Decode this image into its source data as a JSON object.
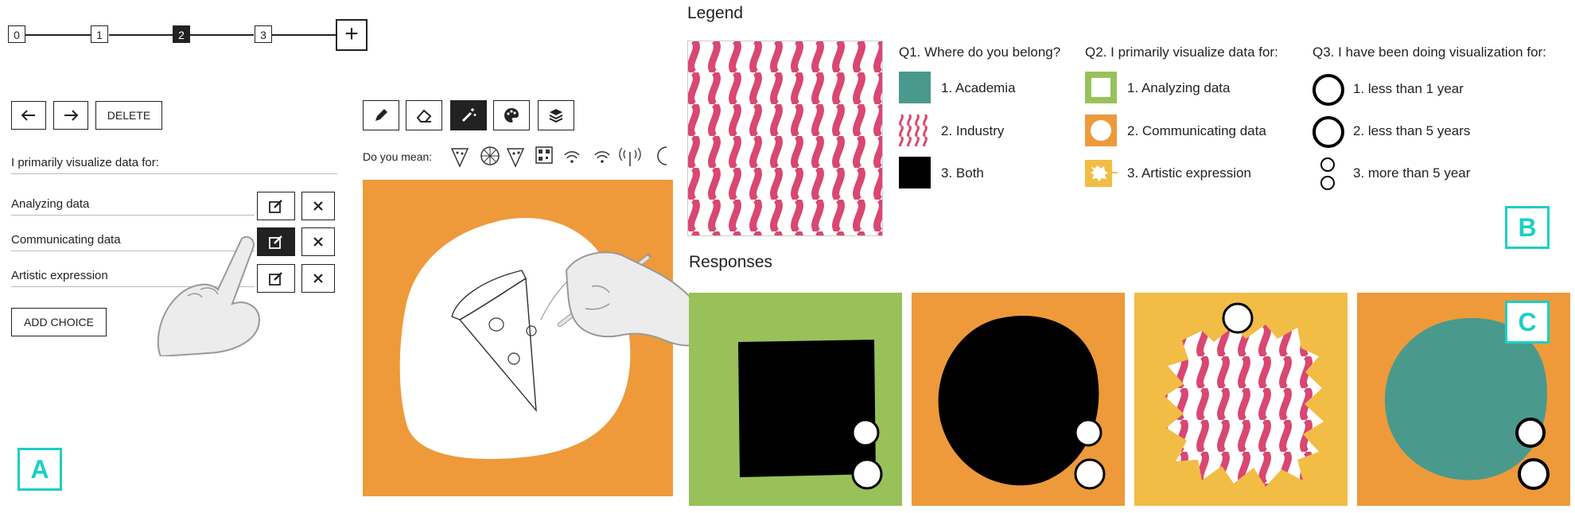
{
  "editor": {
    "steps": [
      "0",
      "1",
      "2",
      "3"
    ],
    "add_step": "+",
    "delete_label": "DELETE",
    "question": "I primarily visualize data for:",
    "choices": [
      "Analyzing data",
      "Communicating data",
      "Artistic expression"
    ],
    "add_choice_label": "ADD CHOICE",
    "suggest_label": "Do you mean:",
    "panel_label": "A"
  },
  "legend": {
    "heading": "Legend",
    "q1": {
      "title": "Q1. Where do you belong?",
      "options": [
        "1. Academia",
        "2. Industry",
        "3. Both"
      ]
    },
    "q2": {
      "title": "Q2. I primarily visualize data for:",
      "options": [
        "1. Analyzing data",
        "2. Communicating data",
        "3. Artistic expression"
      ]
    },
    "q3": {
      "title": "Q3. I have been doing visualization for:",
      "options": [
        "1. less than 1 year",
        "2. less than 5 years",
        "3. more than 5 year"
      ]
    },
    "panel_label": "B"
  },
  "responses": {
    "heading": "Responses",
    "panel_label": "C"
  },
  "colors": {
    "teal": "#4a998d",
    "pink": "#d94772",
    "green": "#99c15a",
    "orange": "#ee9a3a",
    "yellow": "#f2bd45",
    "accent": "#1ccfc5"
  },
  "icons": [
    "arrow-left-icon",
    "arrow-right-icon",
    "edit-icon",
    "close-icon",
    "pencil-icon",
    "eraser-icon",
    "magic-wand-icon",
    "palette-icon",
    "layers-icon",
    "hand-pointer-icon",
    "hand-pen-icon"
  ]
}
